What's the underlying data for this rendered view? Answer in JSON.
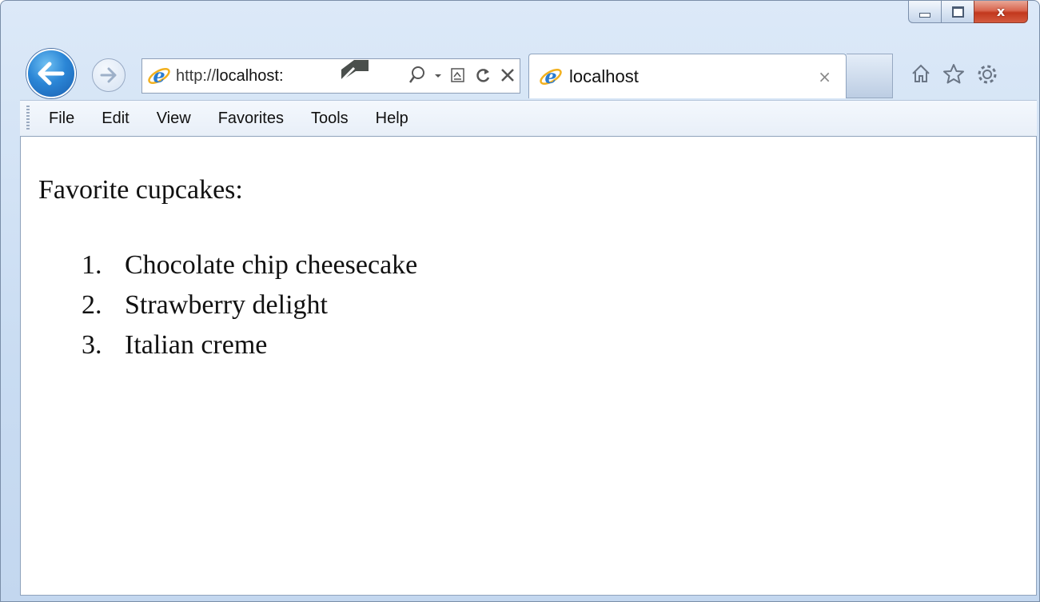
{
  "browser": {
    "address": {
      "url_prefix": "http://",
      "url_host": "localhost:"
    },
    "tab": {
      "title": "localhost",
      "close_symbol": "×"
    },
    "caption": {
      "close_symbol": "x"
    }
  },
  "menu": {
    "items": [
      "File",
      "Edit",
      "View",
      "Favorites",
      "Tools",
      "Help"
    ]
  },
  "page": {
    "heading": "Favorite cupcakes:",
    "list": [
      {
        "number": "1.",
        "text": "Chocolate chip cheesecake"
      },
      {
        "number": "2.",
        "text": "Strawberry delight"
      },
      {
        "number": "3.",
        "text": "Italian creme"
      }
    ]
  },
  "icons": {
    "back": "back-arrow-icon",
    "forward": "forward-arrow-icon",
    "ie": "internet-explorer-icon",
    "search": "search-icon",
    "compat": "compatibility-view-icon",
    "refresh": "refresh-icon",
    "stop": "stop-icon",
    "home": "home-icon",
    "favorites": "favorites-star-icon",
    "tools": "gear-icon"
  },
  "colors": {
    "accent": "#2b86d6",
    "close": "#c2381d",
    "frame": "#c9dcf2"
  }
}
